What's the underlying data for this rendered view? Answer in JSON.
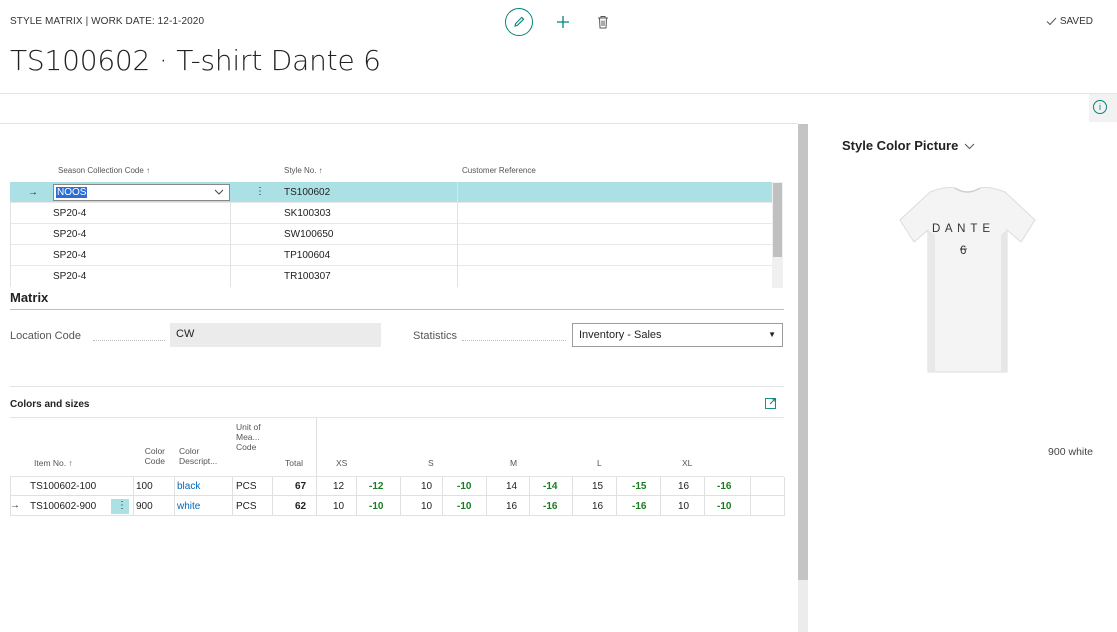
{
  "header": {
    "breadcrumb": "STYLE MATRIX | WORK DATE: 12-1-2020",
    "title": "TS100602 · T-shirt Dante 6",
    "status": "SAVED",
    "status_icon": "check-icon",
    "actions": [
      "edit-icon",
      "add-icon",
      "delete-icon"
    ]
  },
  "season_list": {
    "columns": [
      "Season Collection Code ↑",
      "Style No. ↑",
      "Customer Reference"
    ],
    "rows": [
      {
        "code": "NOOS",
        "style": "TS100602",
        "customer_ref": "",
        "selected": true
      },
      {
        "code": "SP20-4",
        "style": "SK100303",
        "customer_ref": ""
      },
      {
        "code": "SP20-4",
        "style": "SW100650",
        "customer_ref": ""
      },
      {
        "code": "SP20-4",
        "style": "TP100604",
        "customer_ref": ""
      },
      {
        "code": "SP20-4",
        "style": "TR100307",
        "customer_ref": ""
      }
    ],
    "row_marker": "→",
    "more_icon": "⋮"
  },
  "matrix": {
    "title": "Matrix",
    "location_label": "Location Code",
    "location_value": "CW",
    "statistics_label": "Statistics",
    "statistics_value": "Inventory - Sales"
  },
  "colors_sizes": {
    "title": "Colors and sizes",
    "headers": {
      "item_no": "Item No. ↑",
      "color_code": "Color Code",
      "color_desc": "Color Descript...",
      "uom": "Unit of Mea... Code",
      "total": "Total",
      "sizes": [
        "XS",
        "S",
        "M",
        "L",
        "XL"
      ]
    },
    "rows": [
      {
        "item_no": "TS100602-100",
        "color_code": "100",
        "color_desc": "black",
        "uom": "PCS",
        "total": "67",
        "values": [
          "12",
          "-12",
          "10",
          "-10",
          "14",
          "-14",
          "15",
          "-15",
          "16",
          "-16"
        ]
      },
      {
        "item_no": "TS100602-900",
        "color_code": "900",
        "color_desc": "white",
        "uom": "PCS",
        "total": "62",
        "values": [
          "10",
          "-10",
          "10",
          "-10",
          "16",
          "-16",
          "16",
          "-16",
          "10",
          "-10"
        ],
        "selected": true
      }
    ]
  },
  "picture": {
    "title": "Style Color Picture",
    "shirt_text_1": "D A N T E",
    "shirt_text_2": "6",
    "caption": "900 white"
  },
  "colors": {
    "accent": "#00857a",
    "selected_row": "#abe1e5",
    "negative": "#1a7d22",
    "link": "#0067b8"
  }
}
